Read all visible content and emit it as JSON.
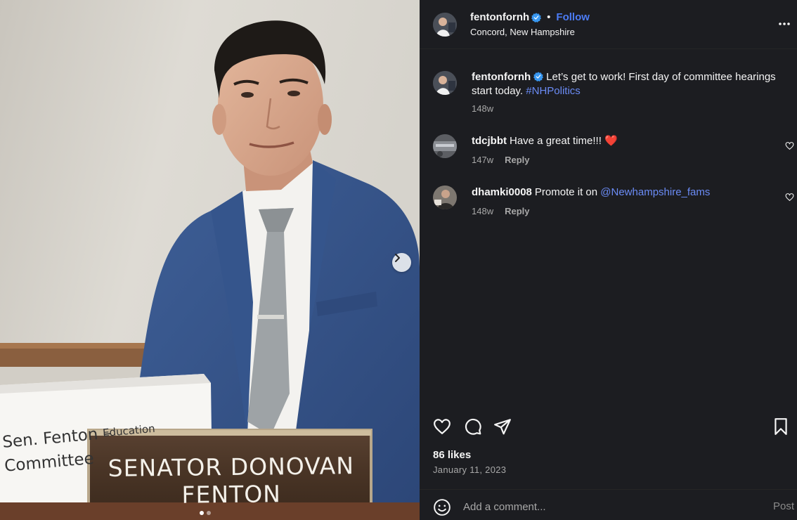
{
  "post": {
    "username": "fentonfornh",
    "verified": true,
    "follow_label": "Follow",
    "separator": "•",
    "location": "Concord, New Hampshire",
    "caption": {
      "text": "Let’s get to work! First day of committee hearings start today.",
      "hashtag": "#NHPolitics",
      "age": "148w"
    },
    "image": {
      "nameplate": "SENATOR DONOVAN FENTON",
      "card_line1": "Sen. Fenton –",
      "card_line1_partial": "Education",
      "card_line2": "Committee",
      "carousel_count": 2,
      "carousel_active": 0
    }
  },
  "comments": [
    {
      "username": "tdcjbbt",
      "text": "Have a great time!!! ❤️",
      "age": "147w",
      "reply_label": "Reply"
    },
    {
      "username": "dhamki0008",
      "text": "Promote it on ",
      "mention": "@Newhampshire_fams",
      "age": "148w",
      "reply_label": "Reply"
    }
  ],
  "stats": {
    "likes": "86 likes",
    "date": "January 11, 2023"
  },
  "composer": {
    "placeholder": "Add a comment...",
    "post_label": "Post"
  },
  "icons": {
    "verified": "verified-badge-icon",
    "more": "more-horizontal-icon",
    "like": "heart-icon",
    "comment": "comment-bubble-icon",
    "share": "paper-plane-icon",
    "save": "bookmark-icon",
    "emoji": "smiley-icon",
    "next": "chevron-right-icon"
  },
  "colors": {
    "panel_bg": "#1c1d21",
    "accent": "#4c7cf6",
    "link": "#6b8cf6",
    "muted": "#a8a8a8",
    "verified": "#3897f0"
  }
}
